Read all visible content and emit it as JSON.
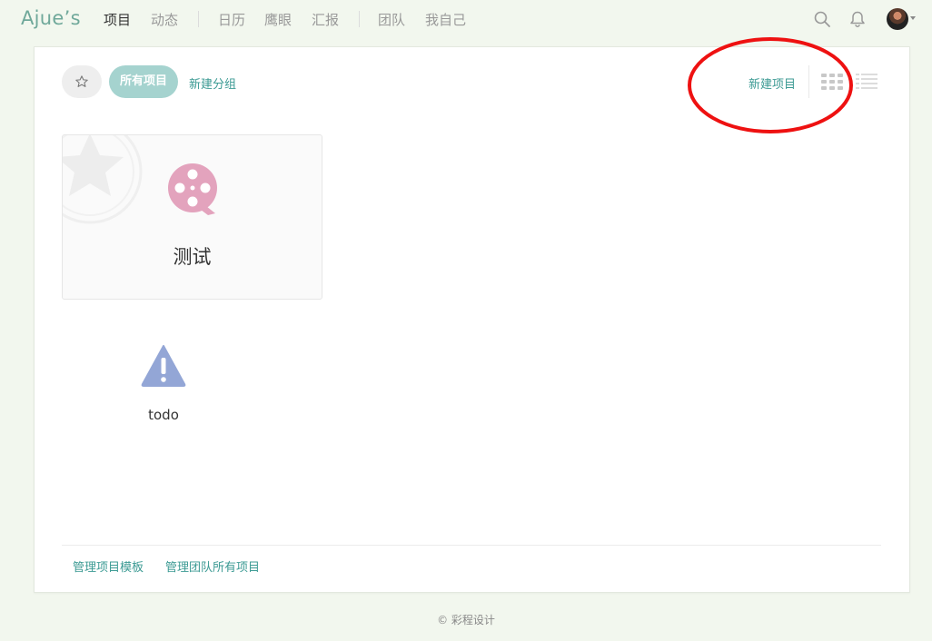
{
  "brand": "Ajue’s",
  "nav": {
    "items": [
      {
        "label": "项目",
        "active": true
      },
      {
        "label": "动态"
      },
      {
        "label": "日历"
      },
      {
        "label": "鹰眼"
      },
      {
        "label": "汇报"
      },
      {
        "label": "团队"
      },
      {
        "label": "我自己"
      }
    ],
    "icons": [
      "search-icon",
      "bell-icon"
    ]
  },
  "toolbar": {
    "filter_active": "所有项目",
    "new_group": "新建分组",
    "new_project": "新建项目",
    "view_modes": [
      "grid-icon",
      "list-icon"
    ]
  },
  "projects": [
    {
      "title": "测试",
      "icon": "film-reel-icon",
      "icon_color": "#e3a3bd"
    }
  ],
  "items": [
    {
      "label": "todo",
      "icon": "warning-icon",
      "icon_color": "#93a6d6"
    }
  ],
  "footer": {
    "manage_templates": "管理项目模板",
    "manage_team_projects": "管理团队所有项目"
  },
  "copyright": "© 彩程设计",
  "colors": {
    "accent": "#3b9a93",
    "pill": "#a5d3cf",
    "annotation": "#ee1111"
  }
}
